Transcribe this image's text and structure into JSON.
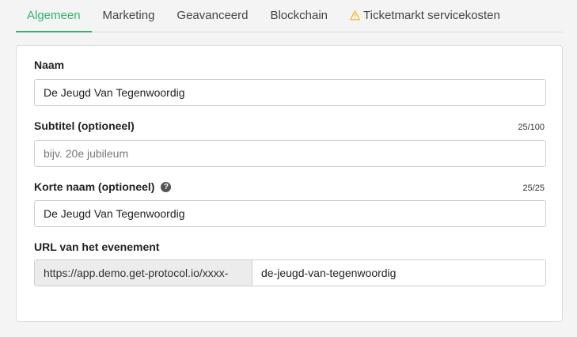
{
  "tabs": [
    {
      "label": "Algemeen"
    },
    {
      "label": "Marketing"
    },
    {
      "label": "Geavanceerd"
    },
    {
      "label": "Blockchain"
    },
    {
      "label": "Ticketmarkt servicekosten"
    }
  ],
  "colors": {
    "accent": "#2fb366",
    "warning": "#f0b429"
  },
  "form": {
    "naam": {
      "label": "Naam",
      "value": "De Jeugd Van Tegenwoordig"
    },
    "subtitel": {
      "label": "Subtitel (optioneel)",
      "counter": "25/100",
      "placeholder": "bijv. 20e jubileum",
      "value": ""
    },
    "korte_naam": {
      "label": "Korte naam (optioneel)",
      "help_icon": "question-circle-icon",
      "help_glyph": "?",
      "counter": "25/25",
      "value": "De Jeugd Van Tegenwoordig"
    },
    "url": {
      "label": "URL van het evenement",
      "prefix": "https://app.demo.get-protocol.io/xxxx-",
      "value": "de-jeugd-van-tegenwoordig"
    }
  }
}
